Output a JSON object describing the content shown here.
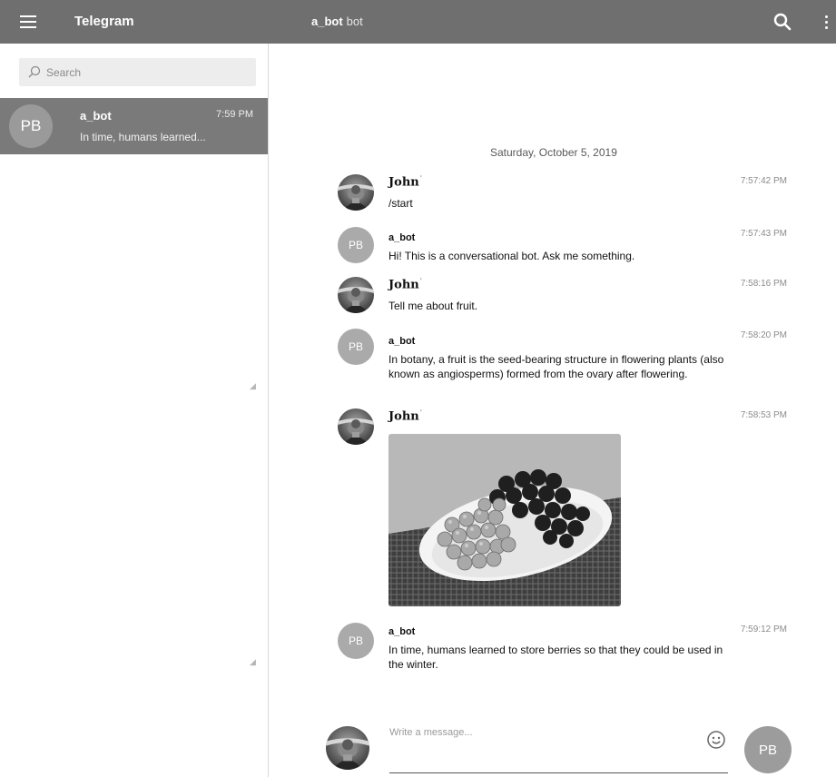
{
  "header": {
    "app_title": "Telegram",
    "chat_name": "a_bot",
    "chat_subtitle": "bot",
    "icons": [
      "menu-icon",
      "search-icon",
      "more-vertical-icon"
    ]
  },
  "sidebar": {
    "search_placeholder": "Search",
    "dialogs": [
      {
        "avatar_initials": "PB",
        "name": "a_bot",
        "time": "7:59 PM",
        "preview": "In time, humans learned..."
      }
    ]
  },
  "chat": {
    "date_separator": "Saturday, October 5, 2019",
    "messages": [
      {
        "author": "John",
        "author_mark": "'",
        "time": "7:57:42 PM",
        "text": "/start"
      },
      {
        "author": "a_bot",
        "avatar_initials": "PB",
        "time": "7:57:43 PM",
        "text": "Hi! This is a conversational bot. Ask me something."
      },
      {
        "author": "John",
        "author_mark": "'",
        "time": "7:58:16 PM",
        "text": "Tell me about fruit."
      },
      {
        "author": "a_bot",
        "avatar_initials": "PB",
        "time": "7:58:20 PM",
        "text": "In botany, a fruit is the seed-bearing structure in flowering plants (also known as angiosperms) formed from the ovary after flowering."
      },
      {
        "author": "John",
        "author_mark": "'",
        "time": "7:58:53 PM",
        "text": "",
        "photo": "grapes-on-plate"
      },
      {
        "author": "a_bot",
        "avatar_initials": "PB",
        "time": "7:59:12 PM",
        "text": "In time, humans learned to store berries so that they could be used in the winter."
      }
    ]
  },
  "composer": {
    "placeholder": "Write a message...",
    "send_avatar_initials": "PB",
    "emoji_icon": "smile-icon"
  }
}
